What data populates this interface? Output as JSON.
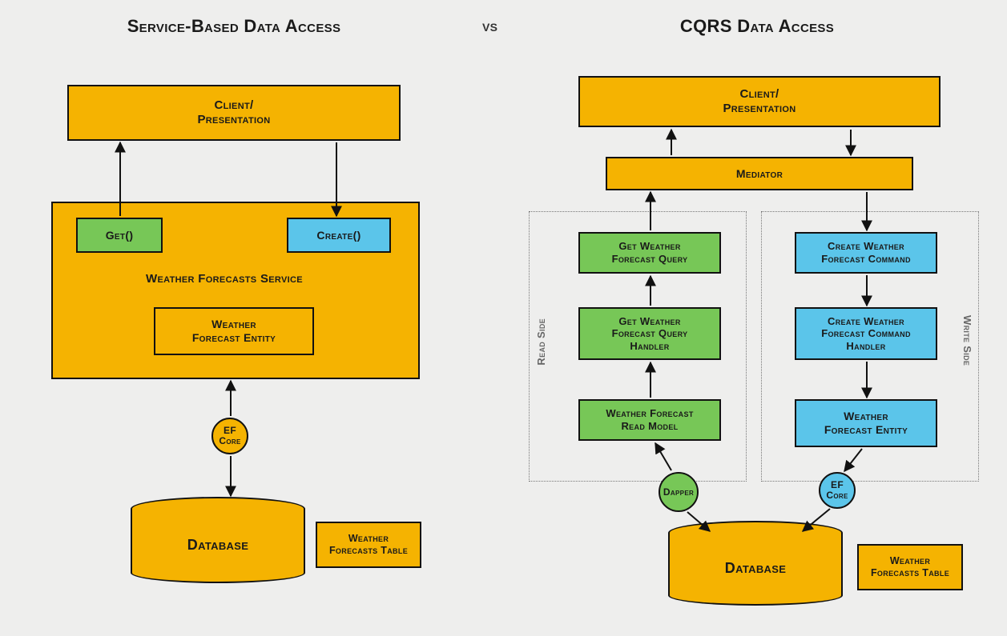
{
  "titles": {
    "left": "Service-Based Data Access",
    "right": "CQRS Data Access",
    "vs": "vs"
  },
  "left": {
    "client": "Client/\nPresentation",
    "get": "Get()",
    "create": "Create()",
    "service_label": "Weather Forecasts Service",
    "entity": "Weather\nForecast Entity",
    "orm": "EF\nCore",
    "database": "Database",
    "table": "Weather\nForecasts Table"
  },
  "right": {
    "client": "Client/\nPresentation",
    "mediator": "Mediator",
    "read_side_label": "Read Side",
    "write_side_label": "Write Side",
    "read": {
      "query": "Get Weather\nForecast Query",
      "handler": "Get Weather\nForecast Query\nHandler",
      "model": "Weather Forecast\nRead Model",
      "orm": "Dapper"
    },
    "write": {
      "command": "Create Weather\nForecast Command",
      "handler": "Create Weather\nForecast Command\nHandler",
      "entity": "Weather\nForecast Entity",
      "orm": "EF\nCore"
    },
    "database": "Database",
    "table": "Weather\nForecasts Table"
  },
  "colors": {
    "yellow": "#f5b301",
    "green": "#77c757",
    "blue": "#5bc5ea",
    "bg": "#eeeeed"
  }
}
